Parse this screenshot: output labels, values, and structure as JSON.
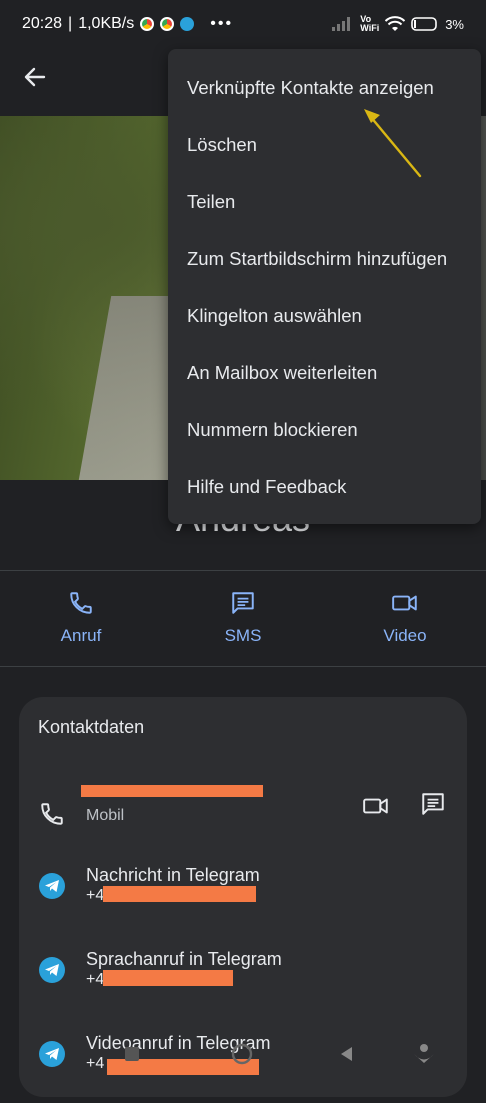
{
  "status_bar": {
    "time": "20:28",
    "net_speed": "1,0KB/s",
    "volte": "Vo",
    "wifi_label": "WiFi",
    "battery": "3%"
  },
  "contact": {
    "name": "Andreas"
  },
  "actions": [
    {
      "label": "Anruf",
      "icon": "phone-icon"
    },
    {
      "label": "SMS",
      "icon": "message-icon"
    },
    {
      "label": "Video",
      "icon": "video-icon"
    }
  ],
  "contact_card": {
    "title": "Kontaktdaten",
    "phone_type": "Mobil",
    "telegram_message": "Nachricht in Telegram",
    "telegram_voice": "Sprachanruf in Telegram",
    "telegram_video": "Videoanruf in Telegram",
    "phone_prefix": "+4"
  },
  "menu": {
    "items": [
      "Verknüpfte Kontakte anzeigen",
      "Löschen",
      "Teilen",
      "Zum Startbildschirm hinzufügen",
      "Klingelton auswählen",
      "An Mailbox weiterleiten",
      "Nummern blockieren",
      "Hilfe und Feedback"
    ]
  },
  "colors": {
    "accent": "#8ab4f8",
    "redaction": "#f47a45",
    "annotation_arrow": "#d9b714",
    "telegram": "#2aa1da"
  }
}
